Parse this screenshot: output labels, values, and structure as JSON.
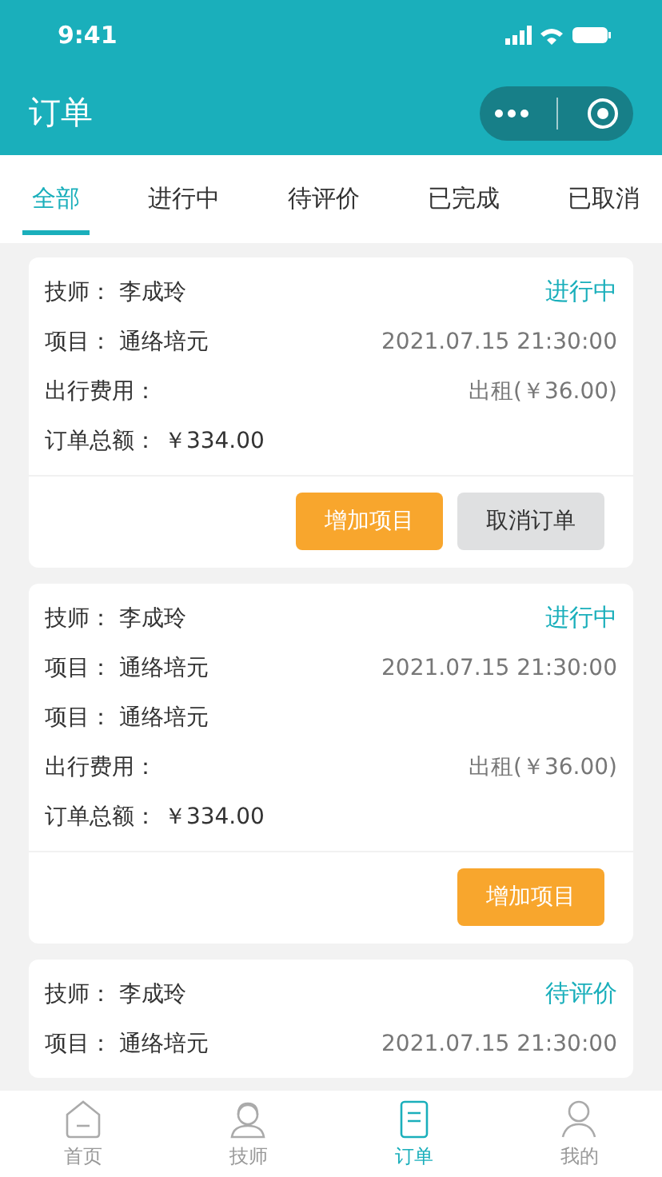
{
  "status_bar": {
    "time": "9:41"
  },
  "header": {
    "title": "订单"
  },
  "tabs": [
    {
      "label": "全部",
      "selected": true
    },
    {
      "label": "进行中",
      "selected": false
    },
    {
      "label": "待评价",
      "selected": false
    },
    {
      "label": "已完成",
      "selected": false
    },
    {
      "label": "已取消",
      "selected": false
    }
  ],
  "orders": [
    {
      "status": "进行中",
      "rows": [
        {
          "label": "技师：",
          "value": "李成玲"
        },
        {
          "label": "项目：",
          "value": "通络培元",
          "right": "2021.07.15 21:30:00"
        },
        {
          "label": "出行费用：",
          "right": "出租(￥36.00)"
        },
        {
          "label": "订单总额：",
          "value": "￥334.00"
        }
      ],
      "buttons": [
        {
          "label": "增加项目",
          "kind": "primary"
        },
        {
          "label": "取消订单",
          "kind": "secondary"
        }
      ]
    },
    {
      "status": "进行中",
      "rows": [
        {
          "label": "技师：",
          "value": "李成玲"
        },
        {
          "label": "项目：",
          "value": "通络培元",
          "right": "2021.07.15 21:30:00"
        },
        {
          "label": "项目：",
          "value": "通络培元"
        },
        {
          "label": "出行费用：",
          "right": "出租(￥36.00)"
        },
        {
          "label": "订单总额：",
          "value": "￥334.00"
        }
      ],
      "buttons": [
        {
          "label": "增加项目",
          "kind": "primary"
        }
      ]
    },
    {
      "status": "待评价",
      "rows": [
        {
          "label": "技师：",
          "value": "李成玲"
        },
        {
          "label": "项目：",
          "value": "通络培元",
          "right": "2021.07.15 21:30:00"
        }
      ]
    }
  ],
  "bottom_nav": [
    {
      "label": "首页",
      "selected": false
    },
    {
      "label": "技师",
      "selected": false
    },
    {
      "label": "订单",
      "selected": true
    },
    {
      "label": "我的",
      "selected": false
    }
  ]
}
